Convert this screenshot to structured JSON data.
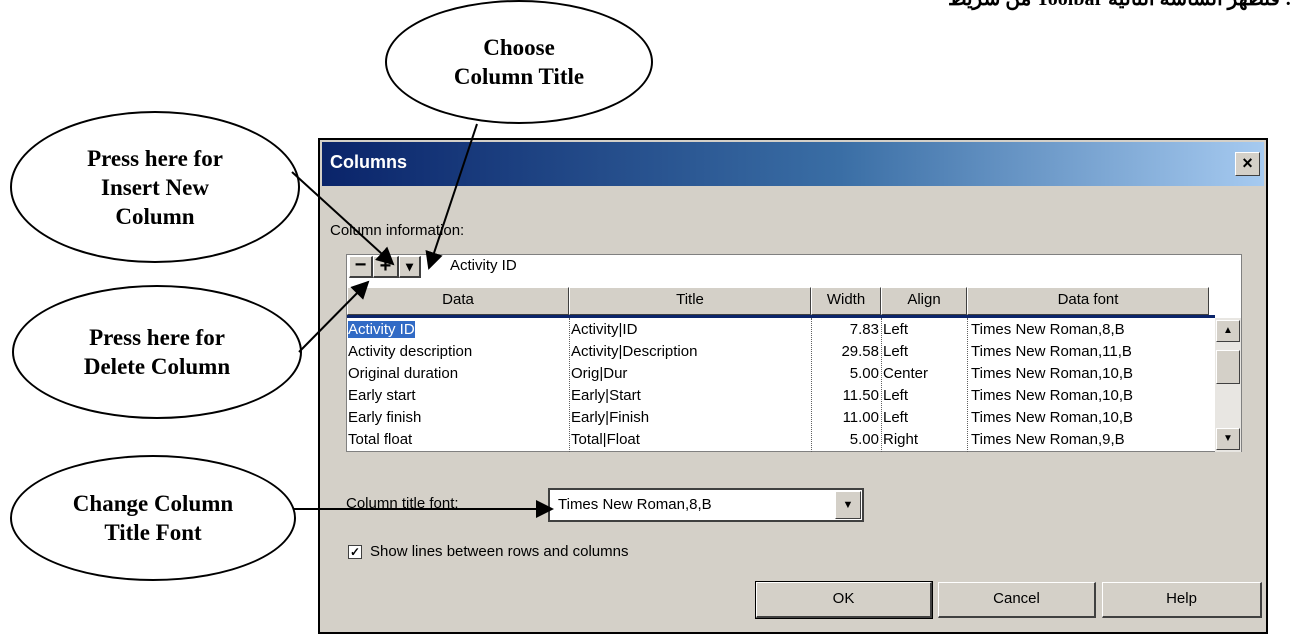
{
  "top_text": "من شريط Toolbar فتظهر الشاشة التالية :",
  "callouts": {
    "choose_title": "Choose\nColumn Title",
    "insert": "Press here for\nInsert New\nColumn",
    "delete": "Press here for\nDelete Column",
    "font": "Change Column\nTitle Font"
  },
  "dialog": {
    "title": "Columns",
    "close": "×",
    "column_information_label": "Column information:",
    "toolbar": {
      "minus": "−",
      "plus": "+",
      "drop": "▾"
    },
    "current_value": "Activity ID",
    "headers": [
      "Data",
      "Title",
      "Width",
      "Align",
      "Data font"
    ],
    "rows": [
      {
        "data": "Activity ID",
        "title": "Activity|ID",
        "width": "7.83",
        "align": "Left",
        "font": "Times New Roman,8,B"
      },
      {
        "data": "Activity description",
        "title": "Activity|Description",
        "width": "29.58",
        "align": "Left",
        "font": "Times New Roman,11,B"
      },
      {
        "data": "Original duration",
        "title": "Orig|Dur",
        "width": "5.00",
        "align": "Center",
        "font": "Times New Roman,10,B"
      },
      {
        "data": "Early start",
        "title": "Early|Start",
        "width": "11.50",
        "align": "Left",
        "font": "Times New Roman,10,B"
      },
      {
        "data": "Early finish",
        "title": "Early|Finish",
        "width": "11.00",
        "align": "Left",
        "font": "Times New Roman,10,B"
      },
      {
        "data": "Total float",
        "title": "Total|Float",
        "width": "5.00",
        "align": "Right",
        "font": "Times New Roman,9,B"
      }
    ],
    "scroll": {
      "up": "▲",
      "down": "▼"
    },
    "column_title_font_label": "Column title font:",
    "column_title_font_value": "Times New Roman,8,B",
    "combo_drop": "▼",
    "show_lines_label": "Show lines between rows and columns",
    "show_lines_checked": "✓",
    "buttons": {
      "ok": "OK",
      "cancel": "Cancel",
      "help": "Help"
    }
  }
}
